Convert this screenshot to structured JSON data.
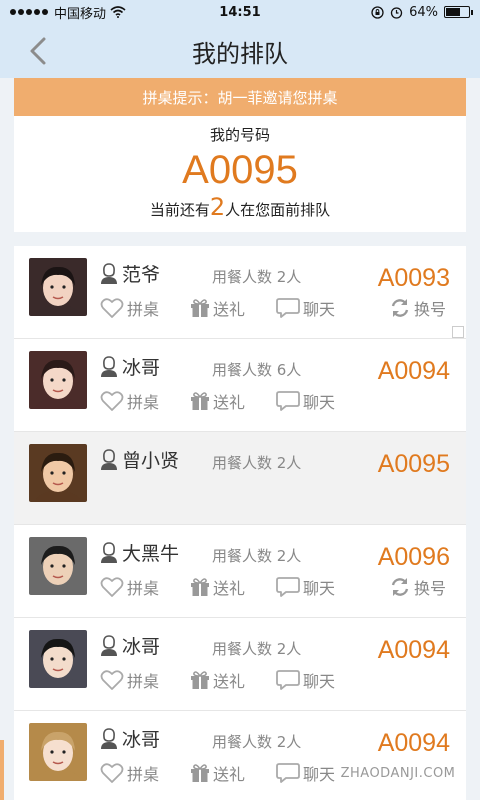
{
  "status": {
    "carrier": "中国移动",
    "time": "14:51",
    "battery": "64%"
  },
  "nav": {
    "title": "我的排队"
  },
  "banner": {
    "text": "拼桌提示：胡一菲邀请您拼桌"
  },
  "my_number": {
    "label": "我的号码",
    "code": "A0095",
    "ahead_prefix": "当前还有",
    "ahead_count": "2",
    "ahead_suffix": "人在您面前排队"
  },
  "actions": {
    "share_table": "拼桌",
    "gift": "送礼",
    "chat": "聊天",
    "swap": "换号"
  },
  "rows": [
    {
      "name": "范爷",
      "diners": "用餐人数  2人",
      "code": "A0093",
      "swap": true
    },
    {
      "name": "冰哥",
      "diners": "用餐人数  6人",
      "code": "A0094",
      "swap": false
    },
    {
      "name": "曾小贤",
      "diners": "用餐人数  2人",
      "code": "A0095",
      "swap": false,
      "current": true
    },
    {
      "name": "大黑牛",
      "diners": "用餐人数  2人",
      "code": "A0096",
      "swap": true
    },
    {
      "name": "冰哥",
      "diners": "用餐人数  2人",
      "code": "A0094",
      "swap": false
    },
    {
      "name": "冰哥",
      "diners": "用餐人数  2人",
      "code": "A0094",
      "swap": false
    }
  ],
  "watermark": "ZHAODANJI.COM",
  "colors": {
    "accent": "#e07a1f",
    "banner": "#f0ad6e",
    "nav": "#d8e8f6"
  }
}
